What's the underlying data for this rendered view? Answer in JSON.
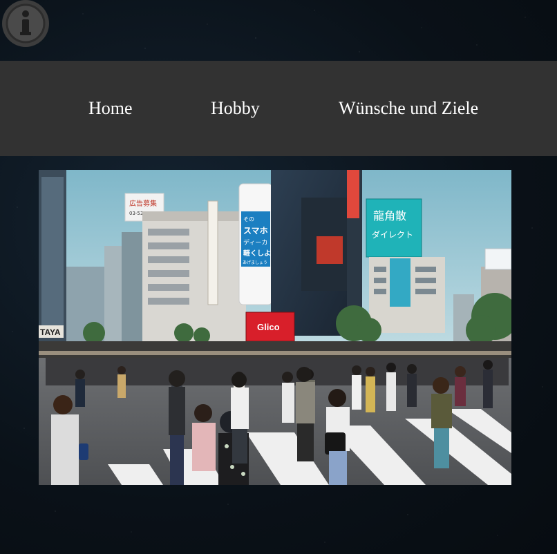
{
  "info_button": {
    "icon": "info-icon",
    "glyph": "i"
  },
  "nav": {
    "items": [
      {
        "label": "Home"
      },
      {
        "label": "Hobby"
      },
      {
        "label": "Wünsche und Ziele"
      }
    ]
  },
  "hero": {
    "subject": "busy pedestrian crossing in front of city buildings with billboards",
    "billboards": {
      "top_left_line1": "広告募集",
      "top_left_line2": "03-5337-2468",
      "left_store_sign": "TAYA",
      "tall_sign_line1": "その",
      "tall_sign_line2": "スマホ",
      "tall_sign_line3": "ディーカ",
      "tall_sign_line4": "軽くしよ",
      "tall_sign_line5": "あげましょう",
      "big_right_line1": "龍角散",
      "big_right_line2": "ダイレクト",
      "red_screen": "Glico"
    }
  },
  "colors": {
    "navbar_bg": "#323232",
    "nav_text": "#ffffff",
    "page_bg": "#0b1219",
    "info_icon": "#4a4a4a"
  }
}
